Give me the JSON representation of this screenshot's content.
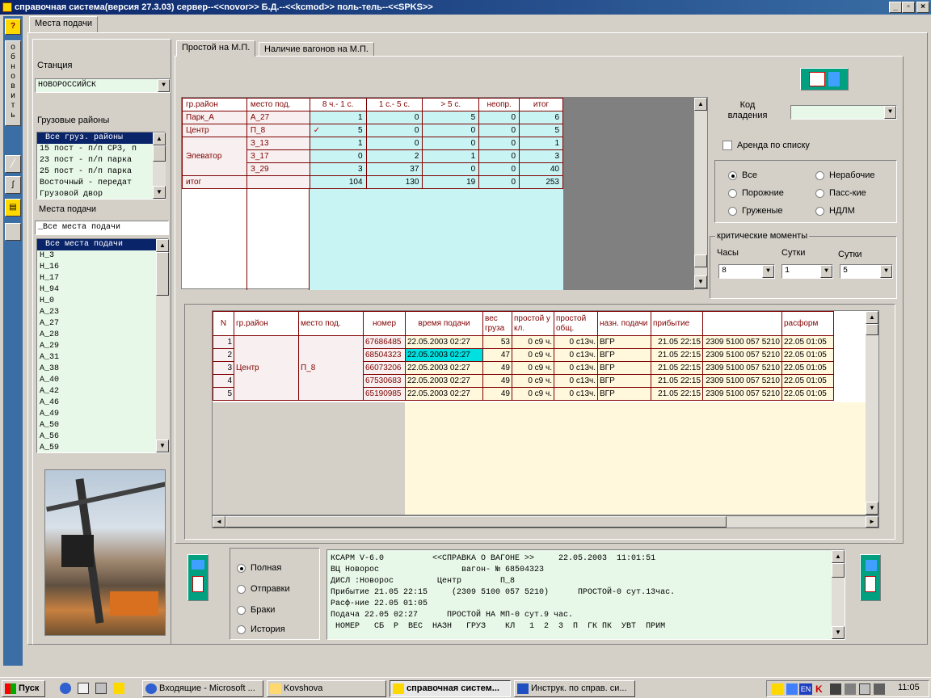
{
  "window": {
    "title": "справочная система(версия 27.3.03) сервер--<<novor>> Б.Д.--<<kcmod>> поль-тель--<<SPKS>>"
  },
  "left_toolbar": {
    "help": "?",
    "refresh_letters": [
      "о",
      "б",
      "н",
      "о",
      "в",
      "и",
      "т",
      "ь"
    ]
  },
  "main_tab": "Места подачи",
  "station": {
    "label": "Станция",
    "value": "НОВОРОССИЙСК"
  },
  "cargo_districts": {
    "label": "Грузовые районы",
    "items": [
      "Все груз. районы",
      "15 пост - п/п СРЗ, п",
      "23 пост - п/п парка",
      "25 пост - п/п парка",
      "Восточный - передат",
      "Грузовой двор"
    ]
  },
  "places": {
    "label": "Места подачи",
    "filter": "_Все места подачи",
    "items": [
      "Все места подачи",
      "Н_3",
      "Н_16",
      "Н_17",
      "Н_94",
      "Н_0",
      "А_23",
      "А_27",
      "А_28",
      "А_29",
      "А_31",
      "А_38",
      "А_40",
      "А_42",
      "А_46",
      "А_49",
      "А_50",
      "А_56",
      "А_59"
    ]
  },
  "subtabs": [
    "Простой на М.П.",
    "Наличие вагонов на М.П."
  ],
  "summary": {
    "headers": [
      "гр.район",
      "место под.",
      "8 ч.- 1 с.",
      "1 с.- 5 с.",
      "> 5 с.",
      "неопр.",
      "итог"
    ],
    "rows": [
      {
        "district": "Парк_А",
        "place": "А_27",
        "check": "",
        "v": [
          "1",
          "0",
          "5",
          "0",
          "6"
        ]
      },
      {
        "district": "Центр",
        "place": "П_8",
        "check": "✓",
        "v": [
          "5",
          "0",
          "0",
          "0",
          "5"
        ]
      },
      {
        "district": "",
        "place": "З_13",
        "check": "",
        "v": [
          "1",
          "0",
          "0",
          "0",
          "1"
        ]
      },
      {
        "district": "Элеватор",
        "place": "З_17",
        "check": "",
        "v": [
          "0",
          "2",
          "1",
          "0",
          "3"
        ]
      },
      {
        "district": "",
        "place": "З_29",
        "check": "",
        "v": [
          "3",
          "37",
          "0",
          "0",
          "40"
        ]
      }
    ],
    "total": {
      "label": "итог",
      "v": [
        "104",
        "130",
        "19",
        "0",
        "253"
      ]
    }
  },
  "ownership": {
    "label": "Код владения",
    "value": ""
  },
  "rent": {
    "label": "Аренда по списку"
  },
  "wagon_filter": {
    "options": [
      "Все",
      "Нерабочие",
      "Порожние",
      "Пасс-кие",
      "Груженые",
      "НДЛМ"
    ],
    "selected": "Все"
  },
  "critical": {
    "legend": "критические моменты",
    "hours_label": "Часы",
    "hours": "8",
    "days1_label": "Сутки",
    "days1": "1",
    "days2_label": "Сутки",
    "days2": "5"
  },
  "wagons": {
    "headers": [
      "N",
      "гр.район",
      "место под.",
      "номер",
      "время подачи",
      "вес груза",
      "простой у кл.",
      "простой общ.",
      "назн. подачи",
      "прибытие",
      "",
      "расформ"
    ],
    "district": "Центр",
    "place": "П_8",
    "rows": [
      {
        "n": "1",
        "num": "67686485",
        "time": "22.05.2003 02:27",
        "w": "53",
        "p1": "0 с9 ч.",
        "p2": "0 с13ч.",
        "dest": "ВГР",
        "arr": "21.05 22:15",
        "train": "2309 5100 057 5210",
        "dis": "22.05 01:05"
      },
      {
        "n": "2",
        "num": "68504323",
        "time": "22.05.2003 02:27",
        "w": "47",
        "p1": "0 с9 ч.",
        "p2": "0 с13ч.",
        "dest": "ВГР",
        "arr": "21.05 22:15",
        "train": "2309 5100 057 5210",
        "dis": "22.05 01:05"
      },
      {
        "n": "3",
        "num": "66073206",
        "time": "22.05.2003 02:27",
        "w": "49",
        "p1": "0 с9 ч.",
        "p2": "0 с13ч.",
        "dest": "ВГР",
        "arr": "21.05 22:15",
        "train": "2309 5100 057 5210",
        "dis": "22.05 01:05"
      },
      {
        "n": "4",
        "num": "67530683",
        "time": "22.05.2003 02:27",
        "w": "49",
        "p1": "0 с9 ч.",
        "p2": "0 с13ч.",
        "dest": "ВГР",
        "arr": "21.05 22:15",
        "train": "2309 5100 057 5210",
        "dis": "22.05 01:05"
      },
      {
        "n": "5",
        "num": "65190985",
        "time": "22.05.2003 02:27",
        "w": "49",
        "p1": "0 с9 ч.",
        "p2": "0 с13ч.",
        "dest": "ВГР",
        "arr": "21.05 22:15",
        "train": "2309 5100 057 5210",
        "dis": "22.05 01:05"
      }
    ]
  },
  "report_type": {
    "options": [
      "Полная",
      "Отправки",
      "Браки",
      "История"
    ],
    "selected": "Полная"
  },
  "report_text": [
    "КСАРМ V-6.0          <<СПРАВКА О ВАГОНЕ >>     22.05.2003  11:01:51",
    "ВЦ Новорос                 вагон- № 68504323",
    "ДИСЛ :Новорос         Центр        П_8",
    "Прибытие 21.05 22:15     (2309 5100 057 5210)      ПРОСТОЙ-0 сут.13час.",
    "Расф-ние 22.05 01:05",
    "Подача 22.05 02:27      ПРОСТОЙ НА МП-0 сут.9 час.",
    " НОМЕР   СБ  Р  ВЕС  НАЗН   ГРУЗ    КЛ   1  2  3  П  ГК ПК  УВТ  ПРИМ"
  ],
  "taskbar": {
    "start": "Пуск",
    "tasks": [
      "Входящие - Microsoft ...",
      "Kovshova",
      "справочная систем...",
      "Инструк. по справ. си..."
    ],
    "lang": "EN",
    "clock": "11:05"
  }
}
